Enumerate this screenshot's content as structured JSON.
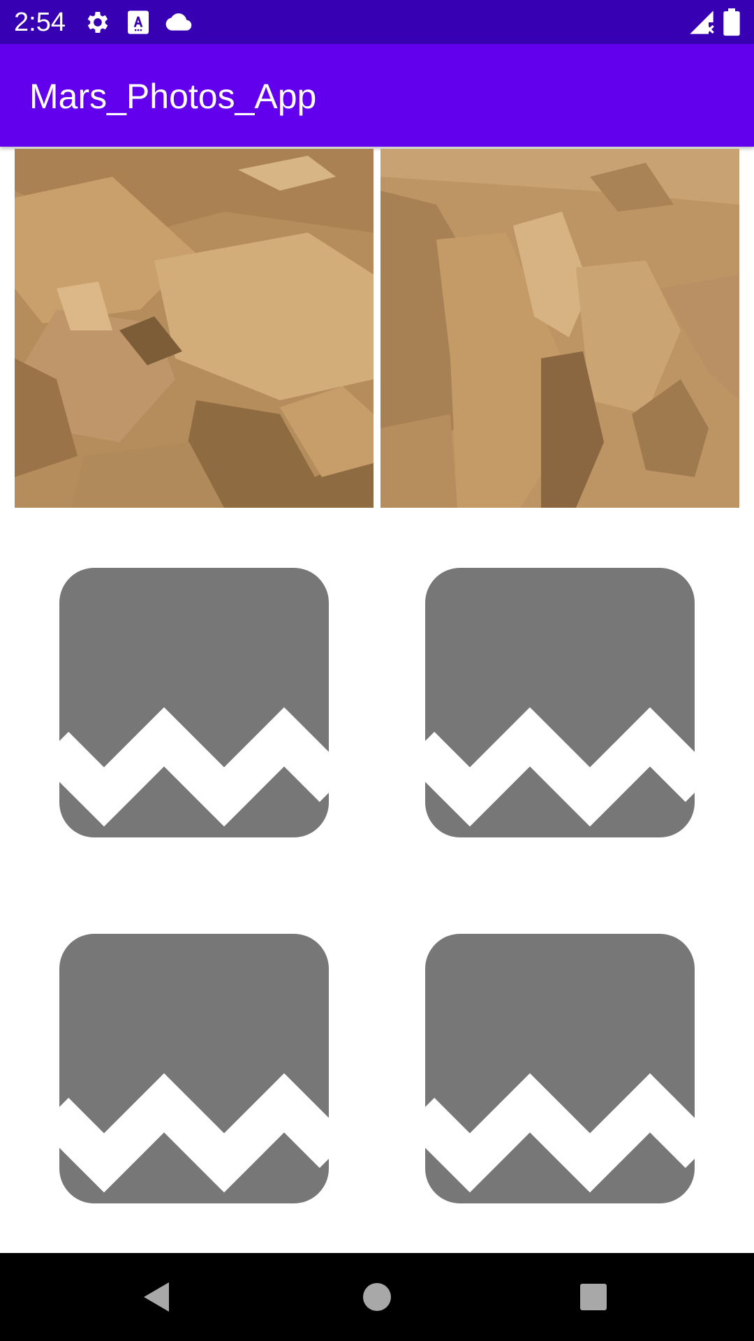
{
  "status_bar": {
    "time": "2:54",
    "icons": [
      "gear-icon",
      "text-a-icon",
      "cloud-icon",
      "signal-off-icon",
      "battery-icon"
    ]
  },
  "app_bar": {
    "title": "Mars_Photos_App"
  },
  "grid": {
    "photos": [
      {
        "state": "loaded",
        "icon": "mars-rock-photo"
      },
      {
        "state": "loaded",
        "icon": "mars-rock-photo"
      },
      {
        "state": "error",
        "icon": "broken-image-icon"
      },
      {
        "state": "error",
        "icon": "broken-image-icon"
      },
      {
        "state": "error",
        "icon": "broken-image-icon"
      },
      {
        "state": "error",
        "icon": "broken-image-icon"
      }
    ],
    "colors": {
      "placeholder_gray": "#777777",
      "mars_sand": "#c9a06c",
      "mars_shadow": "#8a6a44"
    }
  },
  "nav_bar": {
    "buttons": [
      "back-icon",
      "home-icon",
      "recents-icon"
    ]
  },
  "colors": {
    "status_bar": "#3700b3",
    "app_bar": "#6200ee",
    "nav_bar": "#000000"
  }
}
